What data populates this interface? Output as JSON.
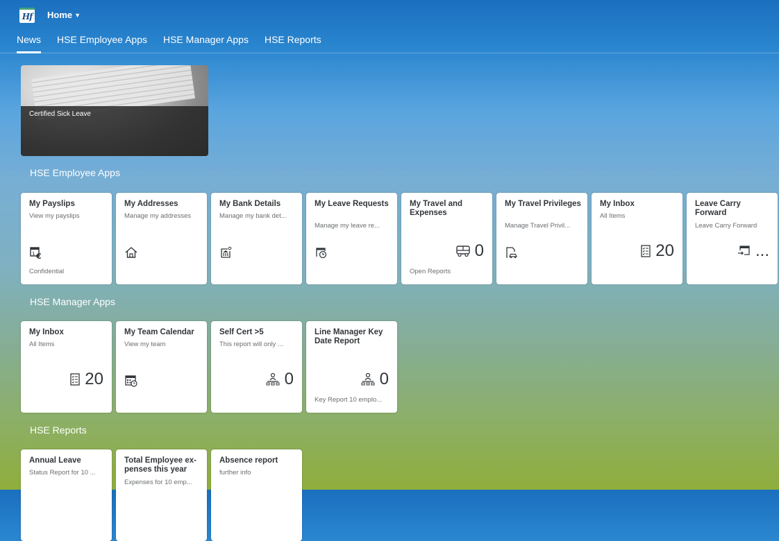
{
  "shell": {
    "logo_text": "Hf",
    "home_title": "Home"
  },
  "tabs": [
    {
      "label": "News"
    },
    {
      "label": "HSE Employee Apps"
    },
    {
      "label": "HSE Manager Apps"
    },
    {
      "label": "HSE Reports"
    }
  ],
  "news": {
    "caption": "Certified Sick Leave"
  },
  "sections": {
    "employee": "HSE Employee Apps",
    "manager": "HSE Manager Apps",
    "reports": "HSE Reports"
  },
  "employee_tiles": [
    {
      "title": "My Payslips",
      "subtitle": "View my payslips",
      "footer": "Confidential",
      "icon": "payslip-calendar-euro-icon"
    },
    {
      "title": "My Addresses",
      "subtitle": "Manage my addresses",
      "icon": "home-icon"
    },
    {
      "title": "My Bank Details",
      "subtitle": "Manage my bank det...",
      "icon": "bank-icon"
    },
    {
      "title": "My Leave Requests",
      "subtitle": "Manage my leave re...",
      "icon": "calendar-clock-icon"
    },
    {
      "title": "My Travel and Expenses",
      "number": "0",
      "footer": "Open Reports",
      "icon": "bus-icon"
    },
    {
      "title": "My Travel Privileges",
      "subtitle": "Manage Travel Privil...",
      "icon": "document-car-icon"
    },
    {
      "title": "My Inbox",
      "subtitle": "All Items",
      "number": "20",
      "icon": "task-list-icon"
    },
    {
      "title": "Leave Carry Forward",
      "subtitle": "Leave Carry Forward",
      "number": "...",
      "icon": "calendar-arrow-icon"
    }
  ],
  "manager_tiles": [
    {
      "title": "My Inbox",
      "subtitle": "All Items",
      "number": "20",
      "icon": "task-list-icon"
    },
    {
      "title": "My Team Calendar",
      "subtitle": "View my team",
      "icon": "team-calendar-icon"
    },
    {
      "title": "Self Cert >5",
      "subtitle": "This report will only ...",
      "number": "0",
      "icon": "org-chart-icon"
    },
    {
      "title": "Line Manager Key Date Report",
      "number": "0",
      "footer": "Key Report 10 emplo...",
      "icon": "org-chart-icon"
    }
  ],
  "report_tiles": [
    {
      "title": "Annual Leave",
      "subtitle": "Status Report for 10 ..."
    },
    {
      "title": "Total Employee ex- penses this year",
      "subtitle": "Expenses for 10 emp..."
    },
    {
      "title": "Absence report",
      "subtitle": "further info"
    }
  ],
  "colors": {
    "tile_title": "#32363a",
    "tile_subtitle": "#6a6d70",
    "tab_text": "#ffffff"
  }
}
